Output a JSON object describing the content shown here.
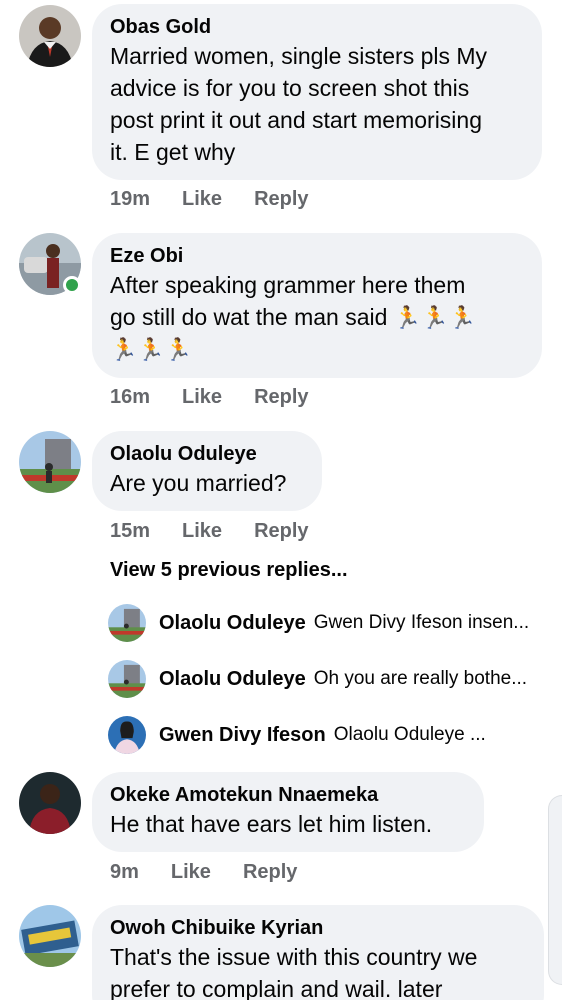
{
  "comments": [
    {
      "author": "Obas Gold",
      "lines": [
        "Married women, single sisters pls My",
        "advice is for you to screen shot this",
        "post print it out and start memorising",
        "it. E get why"
      ],
      "time": "19m",
      "like": "Like",
      "reply": "Reply"
    },
    {
      "author": "Eze Obi",
      "lines": [
        "After speaking grammer here them",
        "go still do wat the man said"
      ],
      "emoji_line1": "🏃🏃🏃",
      "emoji_line2": "🏃🏃🏃",
      "time": "16m",
      "like": "Like",
      "reply": "Reply"
    },
    {
      "author": "Olaolu Oduleye",
      "lines": [
        "Are you married?"
      ],
      "time": "15m",
      "like": "Like",
      "reply": "Reply",
      "view_previous": "View 5 previous replies...",
      "replies": [
        {
          "name": "Olaolu Oduleye",
          "text": "Gwen Divy Ifeson insen..."
        },
        {
          "name": "Olaolu Oduleye",
          "text": "Oh you are really bothe..."
        },
        {
          "name": "Gwen Divy Ifeson",
          "text": "Olaolu Oduleye ..."
        }
      ]
    },
    {
      "author": "Okeke Amotekun Nnaemeka",
      "lines": [
        "He that have ears let him listen."
      ],
      "time": "9m",
      "like": "Like",
      "reply": "Reply"
    },
    {
      "author": "Owoh Chibuike Kyrian",
      "lines": [
        "That's the issue with this country we",
        "prefer to complain and wail. later"
      ]
    }
  ],
  "colors": {
    "bubble": "#f0f2f5",
    "meta": "#65676b",
    "online": "#31a24c"
  }
}
